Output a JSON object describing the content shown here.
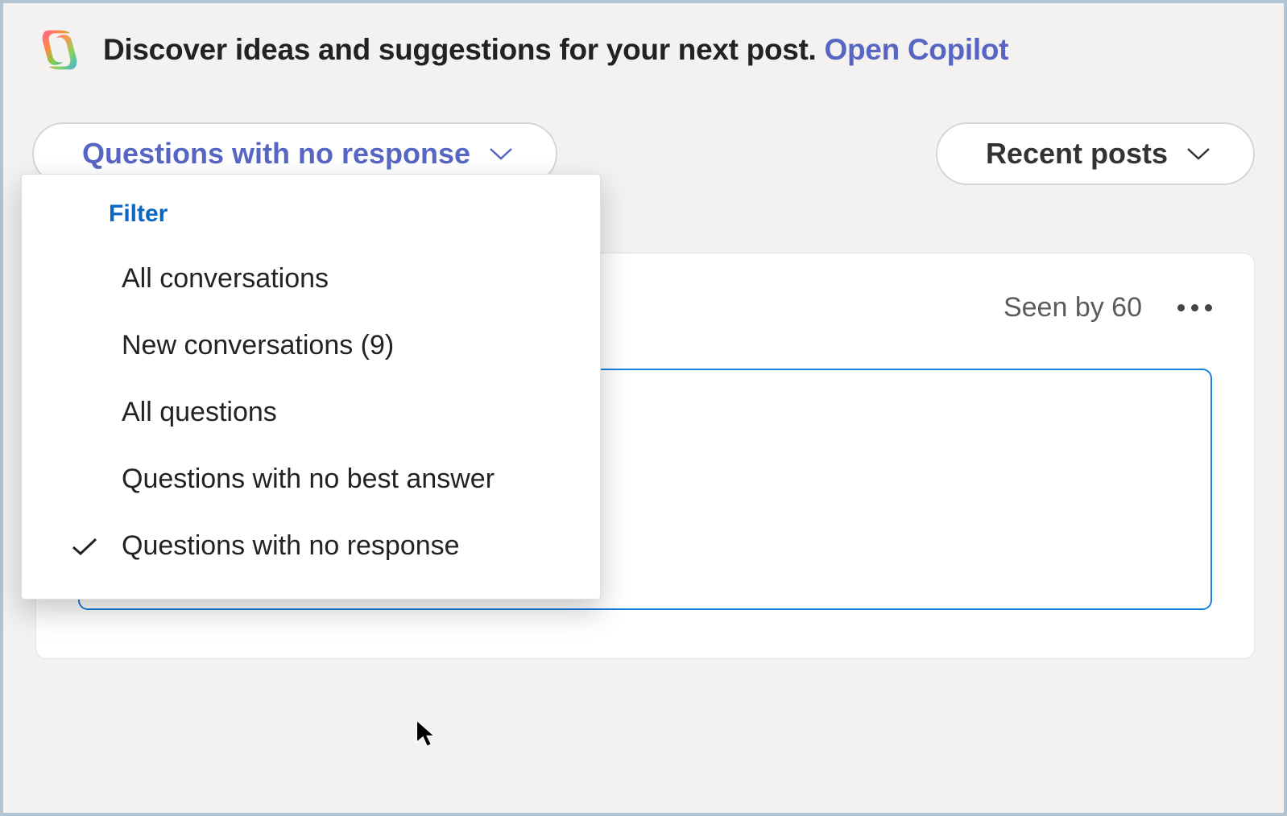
{
  "banner": {
    "text": "Discover ideas and suggestions for your next post.",
    "link_label": "Open Copilot"
  },
  "toolbar": {
    "filter_button_label": "Questions with no response",
    "sort_button_label": "Recent posts"
  },
  "dropdown": {
    "header": "Filter",
    "items": [
      {
        "label": "All conversations",
        "selected": false
      },
      {
        "label": "New conversations (9)",
        "selected": false
      },
      {
        "label": "All questions",
        "selected": false
      },
      {
        "label": "Questions with no best answer",
        "selected": false
      },
      {
        "label": "Questions with no response",
        "selected": true
      }
    ]
  },
  "post": {
    "seen_label": "Seen by 60"
  }
}
